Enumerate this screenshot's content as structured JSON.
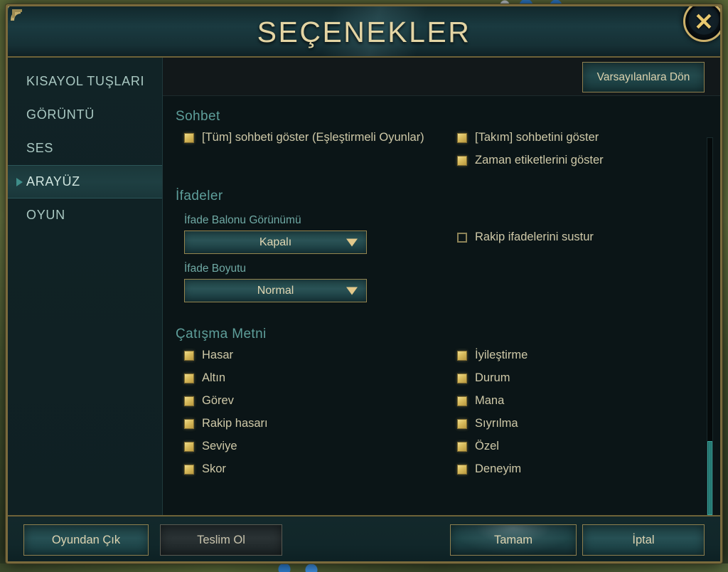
{
  "window": {
    "title": "SEÇENEKLER",
    "close_icon": "close-x-icon"
  },
  "sidebar": {
    "items": [
      {
        "label": "KISAYOL TUŞLARI",
        "active": false
      },
      {
        "label": "GÖRÜNTÜ",
        "active": false
      },
      {
        "label": "SES",
        "active": false
      },
      {
        "label": "ARAYÜZ",
        "active": true
      },
      {
        "label": "OYUN",
        "active": false
      }
    ]
  },
  "toolbar": {
    "reset_label": "Varsayılanlara Dön"
  },
  "sections": {
    "chat": {
      "title": "Sohbet",
      "left": [
        {
          "label": "[Tüm] sohbeti göster (Eşleştirmeli Oyunlar)",
          "checked": true
        }
      ],
      "right": [
        {
          "label": "[Takım] sohbetini göster",
          "checked": true
        },
        {
          "label": "Zaman etiketlerini göster",
          "checked": true
        }
      ]
    },
    "emotes": {
      "title": "İfadeler",
      "bubble_label": "İfade Balonu Görünümü",
      "bubble_value": "Kapalı",
      "size_label": "İfade Boyutu",
      "size_value": "Normal",
      "right": [
        {
          "label": "Rakip ifadelerini sustur",
          "checked": false
        }
      ]
    },
    "combat_text": {
      "title": "Çatışma Metni",
      "left": [
        {
          "label": "Hasar",
          "checked": true
        },
        {
          "label": "Altın",
          "checked": true
        },
        {
          "label": "Görev",
          "checked": true
        },
        {
          "label": "Rakip hasarı",
          "checked": true
        },
        {
          "label": "Seviye",
          "checked": true
        },
        {
          "label": "Skor",
          "checked": true
        }
      ],
      "right": [
        {
          "label": "İyileştirme",
          "checked": true
        },
        {
          "label": "Durum",
          "checked": true
        },
        {
          "label": "Mana",
          "checked": true
        },
        {
          "label": "Sıyrılma",
          "checked": true
        },
        {
          "label": "Özel",
          "checked": true
        },
        {
          "label": "Deneyim",
          "checked": true
        }
      ]
    }
  },
  "footer": {
    "quit_label": "Oyundan Çık",
    "surrender_label": "Teslim Ol",
    "ok_label": "Tamam",
    "cancel_label": "İptal"
  },
  "colors": {
    "gold_border": "#8e8050",
    "accent_teal": "#5e9e9a",
    "title_gold": "#e4d5a4",
    "checkbox_on": "#d9bc5d",
    "scrollbar_thumb": "#2b8a83"
  }
}
